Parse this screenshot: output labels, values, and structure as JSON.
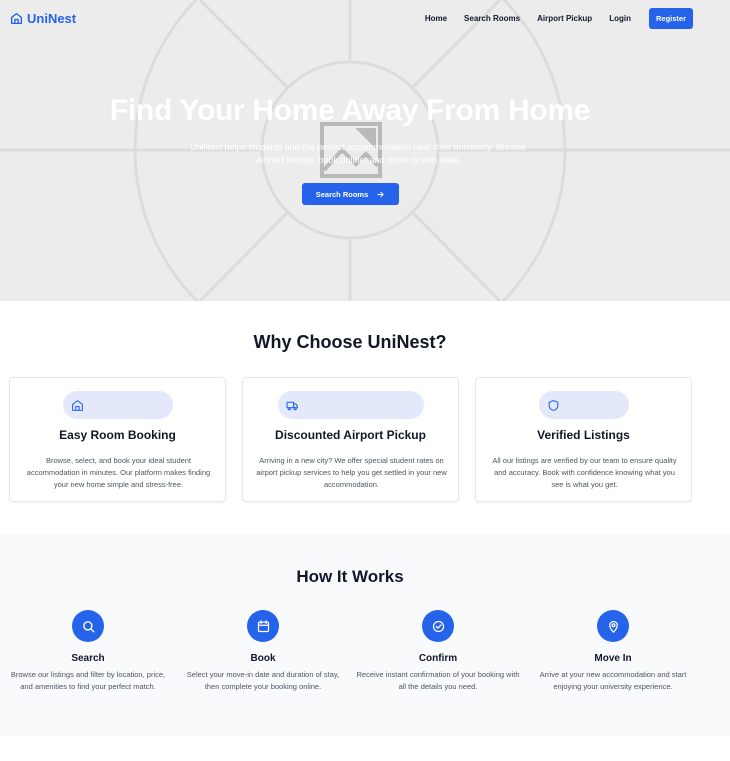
{
  "nav": {
    "brand": "UniNest",
    "links": [
      "Home",
      "Search Rooms",
      "Airport Pickup",
      "Login"
    ],
    "register": "Register"
  },
  "hero": {
    "title": "Find Your Home Away From Home",
    "subtitle": "UniNest helps students find the perfect accommodation near their university. Browse verified listings, book online, and move in with ease.",
    "button": "Search Rooms"
  },
  "why": {
    "title": "Why Choose UniNest?",
    "features": [
      {
        "icon": "home-icon",
        "title": "Easy Room Booking",
        "desc": "Browse, select, and book your ideal student accommodation in minutes. Our platform makes finding your new home simple and stress-free."
      },
      {
        "icon": "truck-icon",
        "title": "Discounted Airport Pickup",
        "desc": "Arriving in a new city? We offer special student rates on airport pickup services to help you get settled in your new accommodation."
      },
      {
        "icon": "shield-icon",
        "title": "Verified Listings",
        "desc": "All our listings are verified by our team to ensure quality and accuracy. Book with confidence knowing what you see is what you get."
      }
    ]
  },
  "how": {
    "title": "How It Works",
    "steps": [
      {
        "icon": "search-icon",
        "title": "Search",
        "desc": "Browse our listings and filter by location, price, and amenities to find your perfect match."
      },
      {
        "icon": "calendar-icon",
        "title": "Book",
        "desc": "Select your move-in date and duration of stay, then complete your booking online."
      },
      {
        "icon": "check-circle-icon",
        "title": "Confirm",
        "desc": "Receive instant confirmation of your booking with all the details you need."
      },
      {
        "icon": "map-pin-icon",
        "title": "Move In",
        "desc": "Arrive at your new accommodation and start enjoying your university experience."
      }
    ]
  },
  "colors": {
    "primary": "#2563eb",
    "hero_bg": "#ececec",
    "pill_bg": "#e3e9fb",
    "section_bg": "#f8fafc"
  }
}
